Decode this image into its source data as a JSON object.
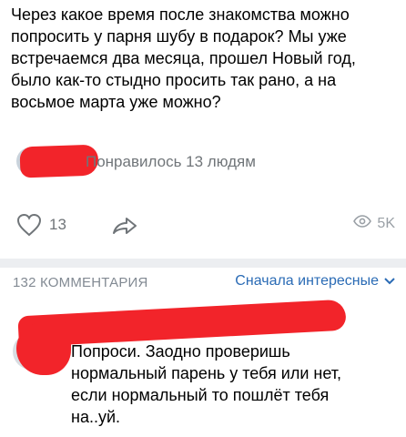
{
  "post": {
    "text": "Через какое время после знакомства можно попросить у парня шубу в подарок? Мы уже встречаемся два месяца, прошел Новый год, было как-то стыдно просить так рано, а на восьмое марта уже можно?",
    "likes_text": "Понравилось 13 людям",
    "like_count": "13",
    "views": "5K"
  },
  "comments": {
    "count_label": "132 КОММЕНТАРИЯ",
    "sort_label": "Сначала интересные",
    "items": [
      {
        "text": "Попроси. Заодно проверишь нормальный парень у тебя или нет, если нормальный то пошлёт тебя на..уй."
      }
    ]
  },
  "colors": {
    "accent": "#2a6bb5",
    "muted": "#707579",
    "redaction": "#f2242a",
    "separator": "#eceef1"
  },
  "icons": {
    "like": "heart-icon",
    "share": "share-arrow-icon",
    "views": "eye-icon",
    "sort": "chevron-down-icon"
  }
}
